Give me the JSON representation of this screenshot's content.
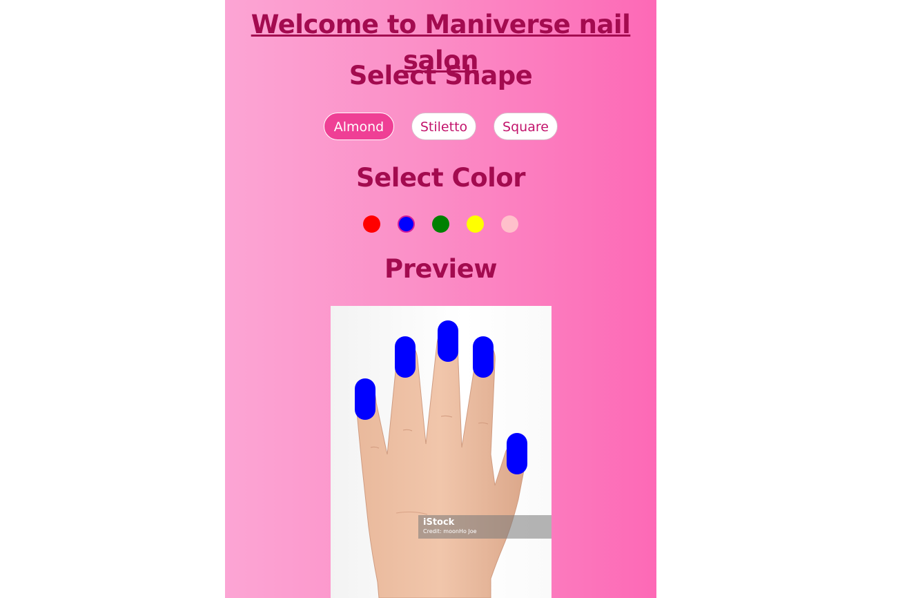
{
  "title": "Welcome to Maniverse nail salon",
  "shape_section": {
    "heading": "Select Shape",
    "options": [
      {
        "label": "Almond",
        "selected": true
      },
      {
        "label": "Stiletto",
        "selected": false
      },
      {
        "label": "Square",
        "selected": false
      }
    ]
  },
  "color_section": {
    "heading": "Select Color",
    "swatches": [
      "#ff0000",
      "#0000ff",
      "#008000",
      "#ffff00",
      "#ffc0cb"
    ],
    "selected": "#0000ff"
  },
  "preview_section": {
    "heading": "Preview",
    "nail_color": "#0000ff",
    "watermark": {
      "brand": "iStock",
      "credit": "Credit: moonHo Joe"
    }
  }
}
